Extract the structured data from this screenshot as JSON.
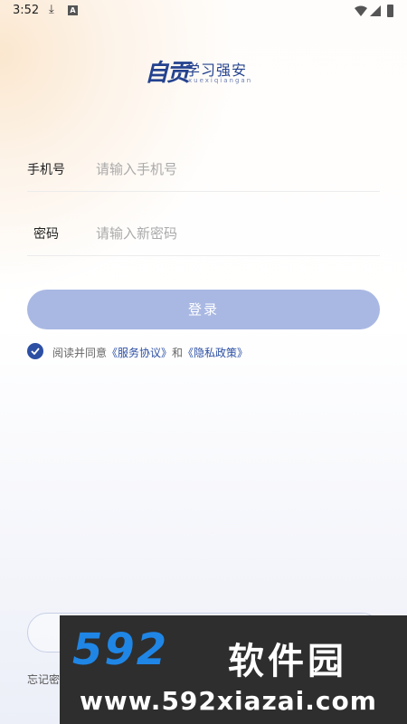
{
  "status_bar": {
    "time": "3:52",
    "notif_icon_label": "A"
  },
  "logo": {
    "calligraphy": "自贡",
    "text": "学习强安",
    "pinyin": "xuexiqiangan"
  },
  "form": {
    "phone_label": "手机号",
    "phone_placeholder": "请输入手机号",
    "password_label": "密码",
    "password_placeholder": "请输入新密码"
  },
  "login_button": "登录",
  "agreement": {
    "prefix": "阅读并同意",
    "service_link": "《服务协议》",
    "and": "和",
    "privacy_link": "《隐私政策》",
    "checked": true
  },
  "forgot_text": "忘记密",
  "watermark": {
    "number": "592",
    "name": "软件园",
    "url": "www.592xiazai.com"
  },
  "colors": {
    "accent": "#2c4fa3",
    "button": "#a9b8e3",
    "watermark_blue": "#1f86e6"
  }
}
